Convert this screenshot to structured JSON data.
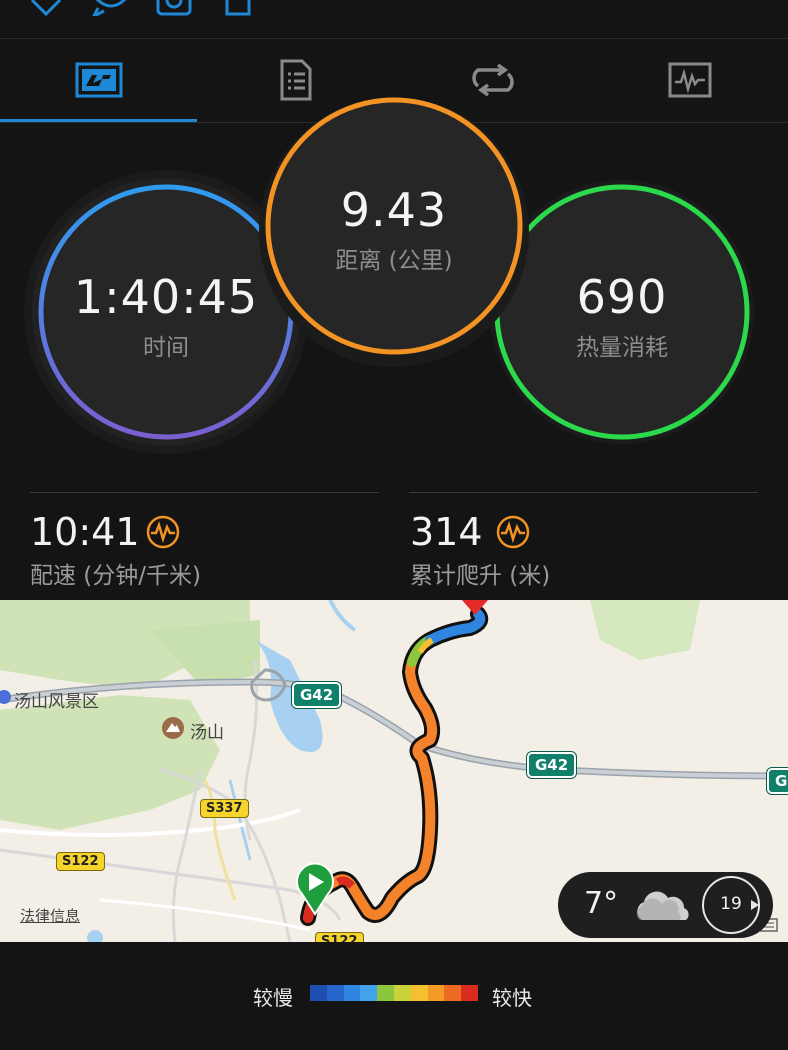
{
  "tabs": {
    "items": [
      {
        "name": "summary"
      },
      {
        "name": "details"
      },
      {
        "name": "laps"
      },
      {
        "name": "charts"
      }
    ],
    "active_color": "#1e88d6"
  },
  "rings": {
    "time": {
      "value": "1:40:45",
      "label": "时间",
      "color_start": "#2e9cf0",
      "color_end": "#7b5fd0"
    },
    "distance": {
      "value": "9.43",
      "label": "距离 (公里)",
      "color": "#f39323"
    },
    "calories": {
      "value": "690",
      "label": "热量消耗",
      "color": "#2bd94a"
    }
  },
  "stats": {
    "pace": {
      "value": "10:41",
      "label": "配速 (分钟/千米)"
    },
    "climb": {
      "value": "314",
      "label": "累计爬升 (米)"
    }
  },
  "map": {
    "places": {
      "scenic": "汤山风景区",
      "mountain": "汤山",
      "legal": "法律信息"
    },
    "roads": {
      "g42_a": "G42",
      "g42_b": "G42",
      "g42_c": "G",
      "s337": "S337",
      "s122_a": "S122",
      "s122_b": "S122"
    },
    "weather": {
      "temperature": "7°",
      "wind": "19"
    }
  },
  "legend": {
    "slow": "较慢",
    "fast": "较快",
    "colors": [
      "#1e4fb0",
      "#2567cc",
      "#2f86e0",
      "#42a2ea",
      "#8cc63f",
      "#c9d23a",
      "#f5c030",
      "#f39a27",
      "#ee6a23",
      "#d92b20"
    ]
  }
}
